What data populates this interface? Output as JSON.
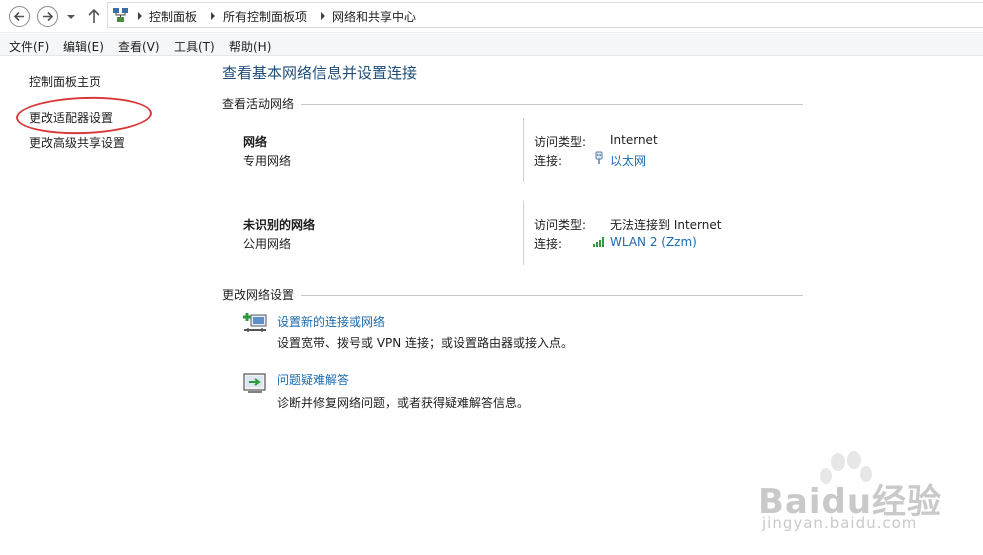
{
  "address": {
    "crumbs": [
      "控制面板",
      "所有控制面板项",
      "网络和共享中心"
    ]
  },
  "menu": {
    "items": [
      "文件(F)",
      "编辑(E)",
      "查看(V)",
      "工具(T)",
      "帮助(H)"
    ]
  },
  "sidebar": {
    "home": "控制面板主页",
    "adapter": "更改适配器设置",
    "sharing": "更改高级共享设置"
  },
  "main": {
    "title": "查看基本网络信息并设置连接",
    "active_heading": "查看活动网络",
    "networks": [
      {
        "name": "网络",
        "type": "专用网络",
        "access_label": "访问类型:",
        "access_value": "Internet",
        "conn_label": "连接:",
        "conn_value": "以太网",
        "conn_icon": "ethernet-icon"
      },
      {
        "name": "未识别的网络",
        "type": "公用网络",
        "access_label": "访问类型:",
        "access_value": "无法连接到 Internet",
        "conn_label": "连接:",
        "conn_value": "WLAN 2 (Zzm)",
        "conn_icon": "wifi-signal-icon"
      }
    ],
    "change_heading": "更改网络设置",
    "tasks": [
      {
        "link": "设置新的连接或网络",
        "desc": "设置宽带、拨号或 VPN 连接；或设置路由器或接入点。",
        "icon": "new-connection-icon"
      },
      {
        "link": "问题疑难解答",
        "desc": "诊断并修复网络问题，或者获得疑难解答信息。",
        "icon": "troubleshoot-icon"
      }
    ]
  },
  "watermark": {
    "brand": "Baidu经验",
    "url": "jingyan.baidu.com"
  },
  "colors": {
    "link": "#1a6bb0",
    "title": "#1e4e79",
    "annotation": "#d9383a"
  }
}
